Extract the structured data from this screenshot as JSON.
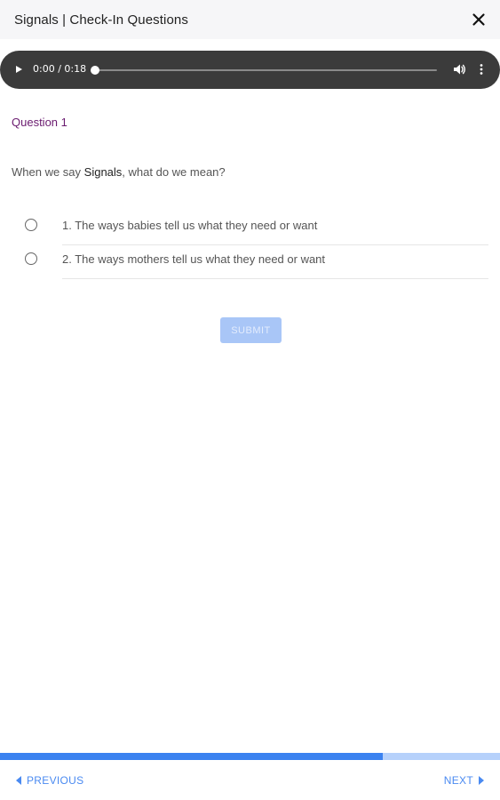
{
  "header": {
    "title": "Signals | Check-In Questions",
    "close_icon": "close-icon"
  },
  "audio": {
    "time": "0:00 / 0:18",
    "progress": 0,
    "icons": [
      "play-icon",
      "volume-icon",
      "more-vertical-icon"
    ]
  },
  "question": {
    "label": "Question 1",
    "text_before": "When we say ",
    "keyword": "Signals",
    "text_after": ", what do we mean?"
  },
  "options": [
    {
      "label": "1. The ways babies tell us what they need or want",
      "selected": false
    },
    {
      "label": "2. The ways mothers tell us what they need or want",
      "selected": false
    }
  ],
  "submit": {
    "label": "SUBMIT",
    "enabled": false
  },
  "progress": {
    "fraction": 0.765
  },
  "nav": {
    "previous_label": "PREVIOUS",
    "next_label": "NEXT"
  },
  "colors": {
    "accent": "#3b82f0",
    "question_label": "#6a1b6f",
    "player_bg": "#3b3b3b"
  }
}
